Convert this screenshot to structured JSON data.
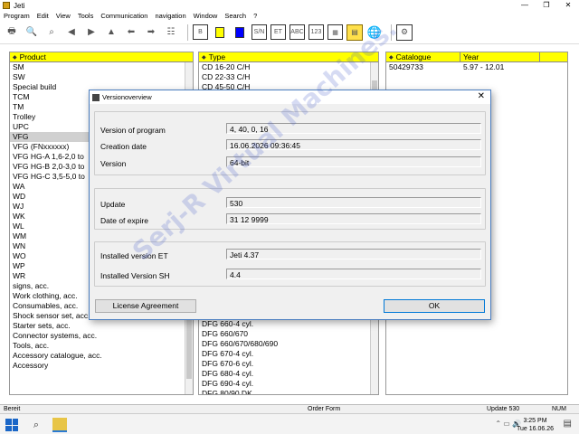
{
  "window": {
    "title": "Jeti",
    "minimize": "—",
    "maximize": "❐",
    "close": "✕"
  },
  "menu": [
    "Program",
    "Edit",
    "View",
    "Tools",
    "Communication",
    "navigation",
    "Window",
    "Search",
    "?"
  ],
  "toolbar": {
    "b_label": "B",
    "sn_label": "S/N",
    "et_label": "ET",
    "abc_label": "ABC",
    "n123_label": "123",
    "grid_label": "▦",
    "icons": [
      "printer-icon",
      "zoom-in-icon",
      "zoom-out-icon",
      "back-icon",
      "forward-icon",
      "up-icon",
      "arrow-left-icon",
      "arrow-right-icon",
      "tree-icon",
      "b-icon",
      "yellow-square-icon",
      "blue-square-icon",
      "sn-icon",
      "et-icon",
      "abc-icon",
      "123-icon",
      "grid-icon",
      "catalog-icon",
      "globe-icon",
      "settings-icon"
    ]
  },
  "product_panel": {
    "header": "Product",
    "items": [
      "SM",
      "SW",
      "Special build",
      "TCM",
      "TM",
      "Trolley",
      "UPC",
      "VFG",
      "VFG (FNxxxxxx)",
      "VFG HG-A 1,6-2,0 to",
      "VFG HG-B 2,0-3,0 to",
      "VFG HG-C 3,5-5,0 to",
      "WA",
      "WD",
      "WJ",
      "WK",
      "WL",
      "WM",
      "WN",
      "WO",
      "WP",
      "WR",
      "signs, acc.",
      "Work clothing, acc.",
      "Consumables, acc.",
      "Shock sensor set, acc.",
      "Starter sets, acc.",
      "Connector systems, acc.",
      "Tools, acc.",
      "Accessory catalogue, acc.",
      "Accessory"
    ],
    "selected_index": 7
  },
  "type_panel": {
    "header": "Type",
    "items_top": [
      "CD 16-20 C/H",
      "CD 22-33 C/H",
      "CD 45-50 C/H"
    ],
    "items_bottom": [
      "DFG 660-4 cyl.",
      "DFG 660/670",
      "DFG 660/670/680/690",
      "DFG 670-4 cyl.",
      "DFG 670-6 cyl.",
      "DFG 680-4 cyl.",
      "DFG 690-4 cyl.",
      "DFG 80/90 DK"
    ]
  },
  "catalogue_panel": {
    "header_catalogue": "Catalogue",
    "header_year": "Year",
    "rows": [
      {
        "catalogue": "50429733",
        "year": "5.97 - 12.01"
      }
    ]
  },
  "dialog": {
    "title": "Versionoverview",
    "close": "✕",
    "group1": [
      {
        "label": "Version of program",
        "value": "4, 40, 0, 16"
      },
      {
        "label": "Creation date",
        "value": "16.06.2026 09:36:45"
      },
      {
        "label": "Version",
        "value": "64-bit"
      }
    ],
    "group2": [
      {
        "label": "Update",
        "value": "530"
      },
      {
        "label": "Date of expire",
        "value": "31 12 9999"
      }
    ],
    "group3": [
      {
        "label": "Installed version ET",
        "value": "Jeti 4.37"
      },
      {
        "label": "Installed Version SH",
        "value": "4.4"
      }
    ],
    "license_button": "License Agreement",
    "ok_button": "OK"
  },
  "watermark": "Serj-R Virtual Machines.",
  "statusbar": {
    "left": "Bereit",
    "order": "Order Form",
    "update": "Update 530",
    "num": "NUM"
  },
  "taskbar": {
    "time": "3:25 PM",
    "date": "Tue 16.06.26",
    "icons": [
      "start-icon",
      "search-icon",
      "task-view-icon",
      "jeti-app-icon"
    ]
  }
}
